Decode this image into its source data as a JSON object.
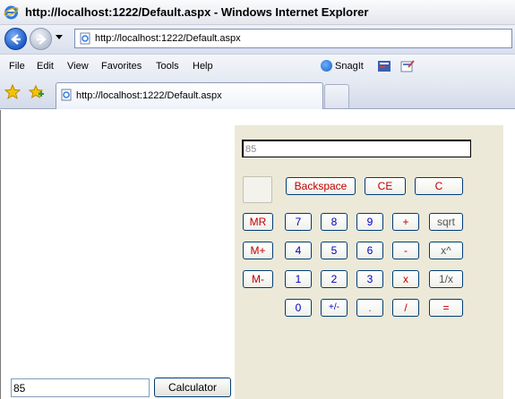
{
  "window": {
    "title": "http://localhost:1222/Default.aspx - Windows Internet Explorer"
  },
  "address_bar": {
    "url": "http://localhost:1222/Default.aspx"
  },
  "menu": {
    "items": [
      "File",
      "Edit",
      "View",
      "Favorites",
      "Tools",
      "Help"
    ],
    "snagit_label": "SnagIt"
  },
  "tabs": [
    {
      "title": "http://localhost:1222/Default.aspx"
    }
  ],
  "calculator": {
    "display_value": "85",
    "top_buttons": [
      "Backspace",
      "CE",
      "C"
    ],
    "memory_buttons": [
      "MR",
      "M+",
      "M-"
    ],
    "rows": [
      [
        "7",
        "8",
        "9",
        "+",
        "sqrt"
      ],
      [
        "4",
        "5",
        "6",
        "-",
        "x^"
      ],
      [
        "1",
        "2",
        "3",
        "x",
        "1/x"
      ],
      [
        "0",
        "+/-",
        ".",
        "/",
        "="
      ]
    ]
  },
  "page": {
    "input_value": "85",
    "calculator_button": "Calculator"
  },
  "colors": {
    "panel_bg": "#ece9d8",
    "red_text": "#c00000",
    "blue_text": "#0000c0"
  }
}
